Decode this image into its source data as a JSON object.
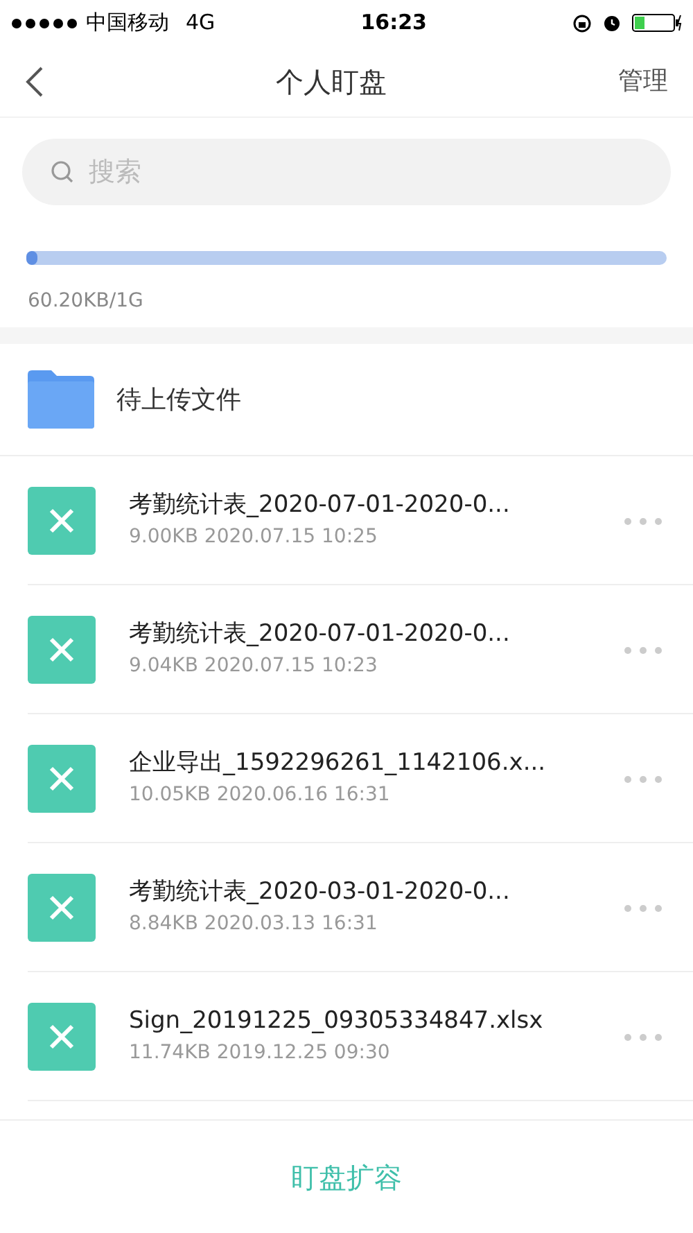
{
  "status_bar": {
    "carrier": "中国移动",
    "network": "4G",
    "time": "16:23"
  },
  "nav": {
    "title": "个人盯盘",
    "action": "管理"
  },
  "search": {
    "placeholder": "搜索"
  },
  "storage": {
    "level": 0.01,
    "reading": "60.20KB/1G"
  },
  "folder": {
    "name": "待上传文件"
  },
  "files": [
    {
      "name": "考勤统计表_2020-07-01-2020-0...",
      "meta": "9.00KB 2020.07.15 10:25"
    },
    {
      "name": "考勤统计表_2020-07-01-2020-0...",
      "meta": "9.04KB 2020.07.15 10:23"
    },
    {
      "name": "企业导出_1592296261_1142106.x...",
      "meta": "10.05KB 2020.06.16 16:31"
    },
    {
      "name": "考勤统计表_2020-03-01-2020-0...",
      "meta": "8.84KB 2020.03.13 16:31"
    },
    {
      "name": "Sign_20191225_09305334847.xlsx",
      "meta": "11.74KB 2019.12.25 09:30"
    }
  ],
  "bottom_button": "盯盘扩容"
}
